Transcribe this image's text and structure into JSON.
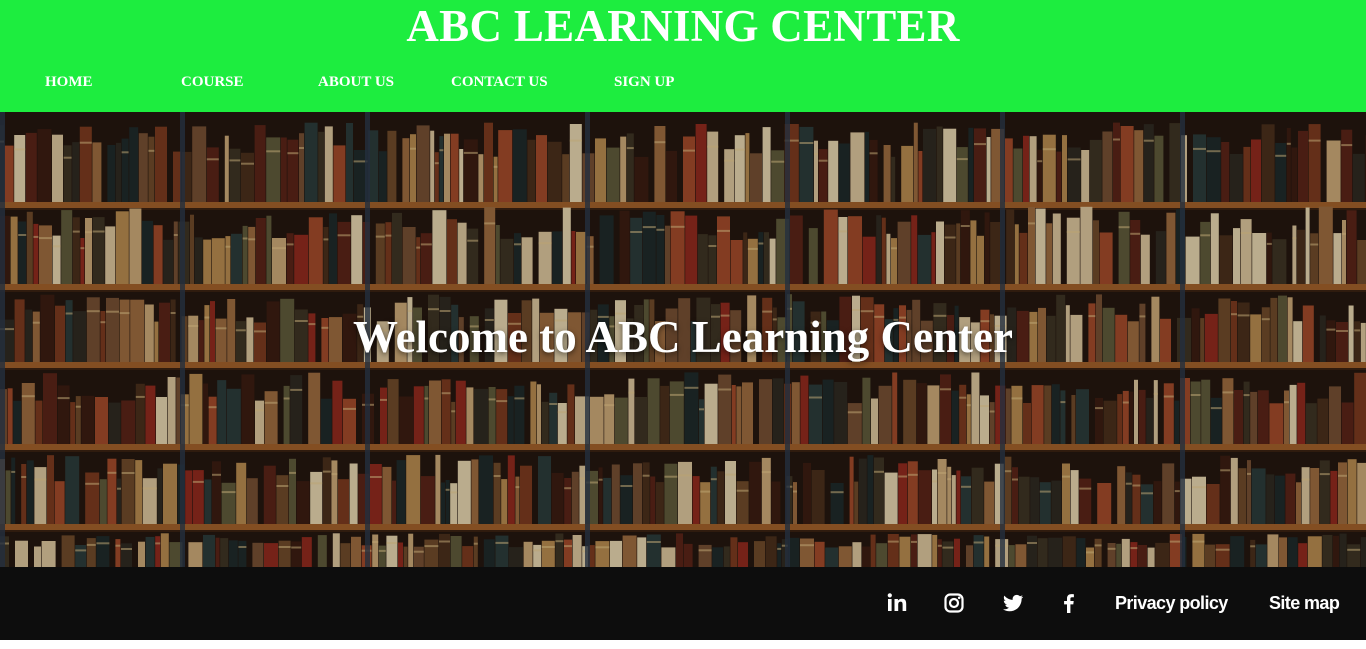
{
  "header": {
    "title": "ABC LEARNING CENTER",
    "background_color": "#1ded3f",
    "nav": [
      {
        "label": "HOME"
      },
      {
        "label": "COURSE"
      },
      {
        "label": "ABOUT US"
      },
      {
        "label": "CONTACT US"
      },
      {
        "label": "SIGN UP"
      }
    ]
  },
  "hero": {
    "title": "Welcome to ABC Learning Center",
    "background": "bookshelf-image"
  },
  "footer": {
    "background_color": "#0d0d0d",
    "social": [
      {
        "icon": "linkedin-icon"
      },
      {
        "icon": "instagram-icon"
      },
      {
        "icon": "twitter-icon"
      },
      {
        "icon": "facebook-icon"
      }
    ],
    "links": [
      {
        "label": "Privacy policy"
      },
      {
        "label": "Site map"
      }
    ]
  }
}
